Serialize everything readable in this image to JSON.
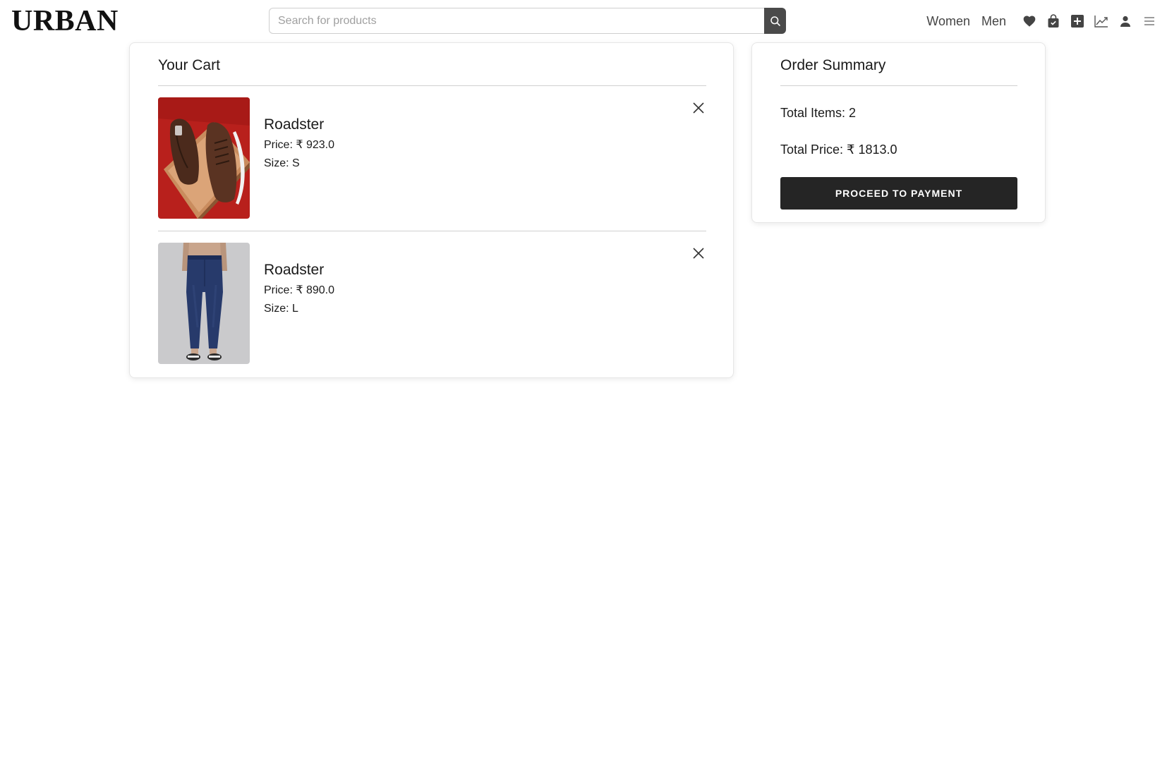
{
  "header": {
    "logo": "URBAN",
    "search": {
      "placeholder": "Search for products",
      "value": ""
    },
    "nav": [
      {
        "label": "Women"
      },
      {
        "label": "Men"
      }
    ],
    "icons": [
      "heart-icon",
      "shopping-bag-icon",
      "add-box-icon",
      "trending-chart-icon",
      "person-icon",
      "menu-icon"
    ]
  },
  "cart": {
    "title": "Your Cart",
    "items": [
      {
        "name": "Roadster",
        "price": "Price: ₹ 923.0",
        "size": "Size: S",
        "image": "brown-leather-sneakers"
      },
      {
        "name": "Roadster",
        "price": "Price: ₹ 890.0",
        "size": "Size: L",
        "image": "navy-blue-jeans"
      }
    ]
  },
  "summary": {
    "title": "Order Summary",
    "total_items": "Total Items: 2",
    "total_price": "Total Price: ₹ 1813.0",
    "button_label": "PROCEED TO PAYMENT"
  },
  "colors": {
    "button_bg": "#252525",
    "search_button_bg": "#4a4a4a",
    "shoe_image_bg": "#b8201c",
    "jeans_image_bg": "#c9c9cb"
  }
}
